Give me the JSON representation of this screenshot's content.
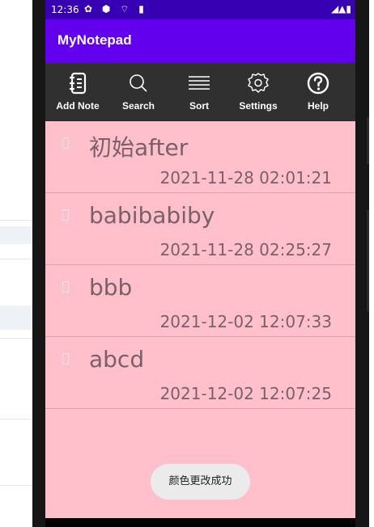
{
  "status_bar": {
    "time": "12:36",
    "icons": "✿ ⬢ ⌔ ▮",
    "right_icons": "◢▲▮"
  },
  "app": {
    "title": "MyNotepad"
  },
  "toolbar": {
    "items": [
      {
        "label": "Add Note",
        "icon": "notebook-icon"
      },
      {
        "label": "Search",
        "icon": "search-icon"
      },
      {
        "label": "Sort",
        "icon": "sort-lines-icon"
      },
      {
        "label": "Settings",
        "icon": "gear-icon"
      },
      {
        "label": "Help",
        "icon": "help-icon"
      }
    ]
  },
  "notes": [
    {
      "title": "初始after",
      "date": "2021-11-28 02:01:21"
    },
    {
      "title": "babibabiby",
      "date": "2021-11-28 02:25:27"
    },
    {
      "title": "bbb",
      "date": "2021-12-02 12:07:33"
    },
    {
      "title": "abcd",
      "date": "2021-12-02 12:07:25"
    }
  ],
  "toast": {
    "message": "颜色更改成功"
  },
  "colors": {
    "status_bar": "#3700b3",
    "app_bar": "#6200ee",
    "toolbar": "#303030",
    "list_background": "#ffc0cb",
    "text": "#7a6167"
  }
}
